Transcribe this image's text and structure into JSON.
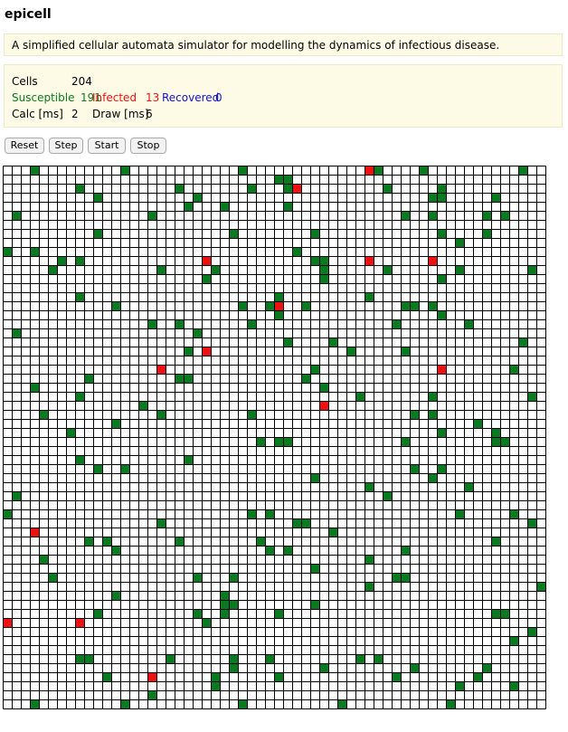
{
  "app": {
    "title": "epicell"
  },
  "description": "A simplified cellular automata simulator for modelling the dynamics of infectious disease.",
  "stats": {
    "cells_label": "Cells",
    "cells_value": "204",
    "susceptible_label": "Susceptible",
    "susceptible_value": "191",
    "infected_label": "Infected",
    "infected_value": "13",
    "recovered_label": "Recovered",
    "recovered_value": "0",
    "calc_label": "Calc [ms]",
    "calc_value": "2",
    "draw_label": "Draw [ms]",
    "draw_value": "6"
  },
  "buttons": {
    "reset": "Reset",
    "step": "Step",
    "start": "Start",
    "stop": "Stop"
  },
  "colors": {
    "susceptible": "#0a7a20",
    "infected": "#ee1111",
    "recovered": "#1414cc",
    "empty": "#ffffff",
    "gridline": "#000000"
  },
  "grid": {
    "cols": 60,
    "rows": 60,
    "infected_cells": [
      [
        40,
        0
      ],
      [
        32,
        2
      ],
      [
        22,
        10
      ],
      [
        40,
        10
      ],
      [
        47,
        10
      ],
      [
        30,
        15
      ],
      [
        22,
        20
      ],
      [
        17,
        22
      ],
      [
        48,
        22
      ],
      [
        35,
        26
      ],
      [
        3,
        40
      ],
      [
        0,
        50
      ],
      [
        8,
        50
      ],
      [
        16,
        56
      ]
    ],
    "susceptible_cells": [
      [
        3,
        0
      ],
      [
        13,
        0
      ],
      [
        26,
        0
      ],
      [
        41,
        0
      ],
      [
        46,
        0
      ],
      [
        57,
        0
      ],
      [
        30,
        1
      ],
      [
        31,
        1
      ],
      [
        8,
        2
      ],
      [
        19,
        2
      ],
      [
        27,
        2
      ],
      [
        31,
        2
      ],
      [
        42,
        2
      ],
      [
        48,
        2
      ],
      [
        10,
        3
      ],
      [
        21,
        3
      ],
      [
        47,
        3
      ],
      [
        48,
        3
      ],
      [
        54,
        3
      ],
      [
        20,
        4
      ],
      [
        24,
        4
      ],
      [
        31,
        4
      ],
      [
        1,
        5
      ],
      [
        16,
        5
      ],
      [
        44,
        5
      ],
      [
        47,
        5
      ],
      [
        53,
        5
      ],
      [
        55,
        5
      ],
      [
        25,
        7
      ],
      [
        34,
        7
      ],
      [
        48,
        7
      ],
      [
        53,
        7
      ],
      [
        10,
        7
      ],
      [
        50,
        8
      ],
      [
        0,
        9
      ],
      [
        3,
        9
      ],
      [
        32,
        9
      ],
      [
        6,
        10
      ],
      [
        8,
        10
      ],
      [
        34,
        10
      ],
      [
        35,
        10
      ],
      [
        23,
        11
      ],
      [
        5,
        11
      ],
      [
        17,
        11
      ],
      [
        35,
        11
      ],
      [
        42,
        11
      ],
      [
        50,
        11
      ],
      [
        58,
        11
      ],
      [
        22,
        12
      ],
      [
        35,
        12
      ],
      [
        48,
        12
      ],
      [
        40,
        14
      ],
      [
        8,
        14
      ],
      [
        12,
        15
      ],
      [
        26,
        15
      ],
      [
        29,
        15
      ],
      [
        30,
        14
      ],
      [
        33,
        15
      ],
      [
        44,
        15
      ],
      [
        45,
        15
      ],
      [
        47,
        15
      ],
      [
        30,
        16
      ],
      [
        48,
        16
      ],
      [
        16,
        17
      ],
      [
        19,
        17
      ],
      [
        27,
        17
      ],
      [
        43,
        17
      ],
      [
        51,
        17
      ],
      [
        1,
        18
      ],
      [
        21,
        18
      ],
      [
        36,
        19
      ],
      [
        31,
        19
      ],
      [
        57,
        19
      ],
      [
        20,
        20
      ],
      [
        38,
        20
      ],
      [
        44,
        20
      ],
      [
        34,
        22
      ],
      [
        56,
        22
      ],
      [
        9,
        23
      ],
      [
        19,
        23
      ],
      [
        20,
        23
      ],
      [
        33,
        23
      ],
      [
        3,
        24
      ],
      [
        35,
        24
      ],
      [
        8,
        25
      ],
      [
        39,
        25
      ],
      [
        47,
        25
      ],
      [
        58,
        25
      ],
      [
        15,
        26
      ],
      [
        4,
        27
      ],
      [
        17,
        27
      ],
      [
        27,
        27
      ],
      [
        45,
        27
      ],
      [
        47,
        27
      ],
      [
        12,
        28
      ],
      [
        52,
        28
      ],
      [
        7,
        29
      ],
      [
        54,
        29
      ],
      [
        48,
        29
      ],
      [
        30,
        30
      ],
      [
        28,
        30
      ],
      [
        31,
        30
      ],
      [
        44,
        30
      ],
      [
        54,
        30
      ],
      [
        55,
        30
      ],
      [
        8,
        32
      ],
      [
        20,
        32
      ],
      [
        10,
        33
      ],
      [
        13,
        33
      ],
      [
        45,
        33
      ],
      [
        48,
        33
      ],
      [
        34,
        34
      ],
      [
        47,
        34
      ],
      [
        40,
        35
      ],
      [
        51,
        35
      ],
      [
        1,
        36
      ],
      [
        42,
        36
      ],
      [
        0,
        38
      ],
      [
        27,
        38
      ],
      [
        29,
        38
      ],
      [
        50,
        38
      ],
      [
        56,
        38
      ],
      [
        17,
        39
      ],
      [
        32,
        39
      ],
      [
        33,
        39
      ],
      [
        58,
        39
      ],
      [
        36,
        40
      ],
      [
        9,
        41
      ],
      [
        11,
        41
      ],
      [
        19,
        41
      ],
      [
        28,
        41
      ],
      [
        54,
        41
      ],
      [
        12,
        42
      ],
      [
        29,
        42
      ],
      [
        31,
        42
      ],
      [
        44,
        42
      ],
      [
        4,
        43
      ],
      [
        40,
        43
      ],
      [
        34,
        44
      ],
      [
        21,
        45
      ],
      [
        5,
        45
      ],
      [
        25,
        45
      ],
      [
        43,
        45
      ],
      [
        44,
        45
      ],
      [
        40,
        46
      ],
      [
        59,
        46
      ],
      [
        12,
        47
      ],
      [
        24,
        47
      ],
      [
        24,
        48
      ],
      [
        25,
        48
      ],
      [
        34,
        48
      ],
      [
        10,
        49
      ],
      [
        21,
        49
      ],
      [
        30,
        49
      ],
      [
        55,
        49
      ],
      [
        24,
        49
      ],
      [
        54,
        49
      ],
      [
        22,
        50
      ],
      [
        58,
        51
      ],
      [
        56,
        52
      ],
      [
        8,
        54
      ],
      [
        9,
        54
      ],
      [
        18,
        54
      ],
      [
        25,
        54
      ],
      [
        29,
        54
      ],
      [
        39,
        54
      ],
      [
        41,
        54
      ],
      [
        25,
        55
      ],
      [
        35,
        55
      ],
      [
        45,
        55
      ],
      [
        53,
        55
      ],
      [
        11,
        56
      ],
      [
        23,
        56
      ],
      [
        30,
        56
      ],
      [
        43,
        56
      ],
      [
        52,
        56
      ],
      [
        23,
        57
      ],
      [
        50,
        57
      ],
      [
        56,
        57
      ],
      [
        16,
        58
      ],
      [
        26,
        59
      ],
      [
        3,
        59
      ],
      [
        13,
        59
      ],
      [
        37,
        59
      ],
      [
        49,
        59
      ]
    ]
  }
}
